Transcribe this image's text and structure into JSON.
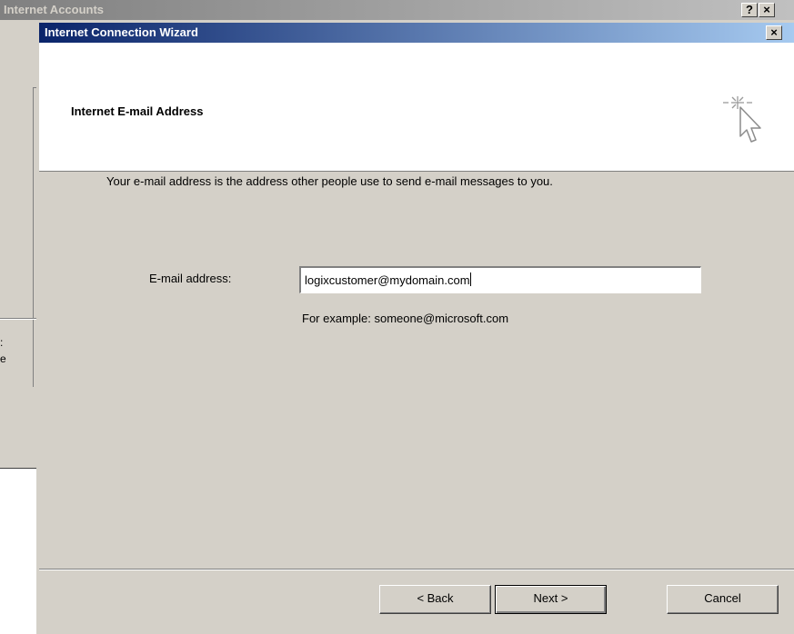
{
  "background_window": {
    "title": "Internet Accounts",
    "help_label": "?",
    "close_label": "×",
    "partial_text_1": ":",
    "partial_text_2": "e"
  },
  "wizard": {
    "title": "Internet Connection Wizard",
    "close_label": "×",
    "header": {
      "title": "Internet E-mail Address",
      "icon": "wizard-cursor-sparkle-icon"
    },
    "intro_text": "Your e-mail address is the address other people use to send e-mail messages to you.",
    "email": {
      "label": "E-mail address:",
      "value": "logixcustomer@mydomain.com",
      "example": "For example: someone@microsoft.com"
    },
    "buttons": {
      "back": "< Back",
      "next": "Next >",
      "cancel": "Cancel"
    }
  },
  "colors": {
    "dialog_face": "#d4d0c8",
    "active_title_start": "#0a246a",
    "active_title_end": "#a6caf0",
    "inactive_title_start": "#808080",
    "inactive_title_end": "#c0c0c0"
  }
}
